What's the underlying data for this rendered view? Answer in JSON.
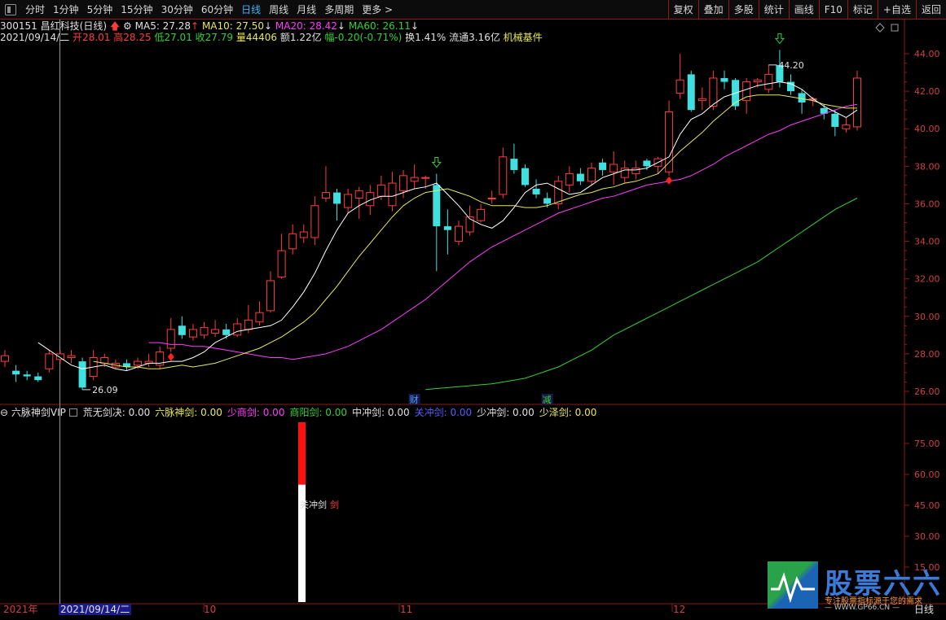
{
  "toolbar": {
    "periods": [
      "分时",
      "1分钟",
      "5分钟",
      "15分钟",
      "30分钟",
      "60分钟",
      "日线",
      "周线",
      "月线",
      "多周期",
      "更多 >"
    ],
    "active_period": "日线",
    "right_buttons": [
      "复权",
      "叠加",
      "多股",
      "统计",
      "画线",
      "F10",
      "标记",
      "+自选",
      "返回"
    ]
  },
  "stock": {
    "code": "300151",
    "name": "昌红科技",
    "period_label": "(日线)",
    "ma5_label": "MA5: 27.28",
    "ma10_label": "MA10: 27.50",
    "ma20_label": "MA20: 28.42",
    "ma60_label": "MA60: 26.11"
  },
  "quote": {
    "date": "2021/09/14/二",
    "open_label": "开",
    "open": "28.01",
    "high_label": "高",
    "high": "28.25",
    "low_label": "低",
    "low": "27.01",
    "close_label": "收",
    "close": "27.79",
    "volume_label": "量",
    "volume": "44406",
    "amount": "额1.22亿",
    "change": "幅-0.20(-0.71%)",
    "turnover": "换1.41%",
    "float_cap": "流通3.16亿",
    "sector": "机械基件"
  },
  "price_axis": [
    "44.00",
    "42.00",
    "40.00",
    "38.00",
    "36.00",
    "34.00",
    "32.00",
    "30.00",
    "28.00",
    "26.00"
  ],
  "annotations": {
    "high_mark": "44.20",
    "low_mark": "26.09",
    "event1": "财",
    "event2": "减"
  },
  "indicator": {
    "name": "六脉神剑VIP",
    "items": [
      {
        "label": "荒无剑决: 0.00",
        "color": "#e0e0e0"
      },
      {
        "label": "六脉神剑: 0.00",
        "color": "#e8e85a"
      },
      {
        "label": "少商剑: 0.00",
        "color": "#ff3cff"
      },
      {
        "label": "商阳剑: 0.00",
        "color": "#34d134"
      },
      {
        "label": "中冲剑: 0.00",
        "color": "#e0e0e0"
      },
      {
        "label": "关冲剑: 0.00",
        "color": "#5a5aff"
      },
      {
        "label": "少冲剑: 0.00",
        "color": "#e0e0e0"
      },
      {
        "label": "少泽剑: 0.00",
        "color": "#e8e85a"
      }
    ],
    "axis": [
      "75.00",
      "60.00",
      "45.00",
      "30.00",
      "15.00"
    ],
    "bar_label_1": "关冲剑",
    "bar_label_2": "剑"
  },
  "time_axis": {
    "year": "2021年",
    "cursor_date": "2021/09/14/二",
    "months": [
      "10",
      "11",
      "12"
    ],
    "right_label": "日线"
  },
  "logo": {
    "title": "股票六六",
    "subtitle": "专注股票指标源于您的需求",
    "url": "— WWW.GP66.CN —"
  },
  "colors": {
    "up": "#ff3c3c",
    "down": "#40e0e0",
    "ma5": "#ffffff",
    "ma10": "#e8e85a",
    "ma20": "#ff3cff",
    "ma60": "#34d134",
    "frame": "#8b1a1a"
  },
  "chart_data": {
    "type": "candlestick",
    "price_range": [
      25.5,
      44.8
    ],
    "candles": [
      {
        "o": 27.6,
        "c": 27.9,
        "h": 28.2,
        "l": 27.3
      },
      {
        "o": 27.1,
        "c": 26.9,
        "h": 27.4,
        "l": 26.5
      },
      {
        "o": 26.9,
        "c": 26.8,
        "h": 27.1,
        "l": 26.6
      },
      {
        "o": 26.8,
        "c": 26.6,
        "h": 27.0,
        "l": 26.5
      },
      {
        "o": 27.2,
        "c": 28.0,
        "h": 28.2,
        "l": 27.0
      },
      {
        "o": 27.7,
        "c": 28.0,
        "h": 28.2,
        "l": 27.5
      },
      {
        "o": 27.8,
        "c": 27.9,
        "h": 28.2,
        "l": 27.5
      },
      {
        "o": 27.6,
        "c": 26.2,
        "h": 27.8,
        "l": 26.09
      },
      {
        "o": 26.8,
        "c": 27.8,
        "h": 28.2,
        "l": 26.6
      },
      {
        "o": 27.5,
        "c": 27.8,
        "h": 28.0,
        "l": 27.3
      },
      {
        "o": 27.3,
        "c": 27.5,
        "h": 27.7,
        "l": 27.2
      },
      {
        "o": 27.5,
        "c": 27.3,
        "h": 27.7,
        "l": 27.1
      },
      {
        "o": 27.4,
        "c": 27.6,
        "h": 27.8,
        "l": 27.2
      },
      {
        "o": 27.5,
        "c": 27.6,
        "h": 28.0,
        "l": 27.3
      },
      {
        "o": 27.4,
        "c": 28.1,
        "h": 28.4,
        "l": 27.2
      },
      {
        "o": 28.3,
        "c": 29.3,
        "h": 29.9,
        "l": 28.1
      },
      {
        "o": 29.5,
        "c": 29.0,
        "h": 30.0,
        "l": 28.8
      },
      {
        "o": 28.9,
        "c": 29.3,
        "h": 29.6,
        "l": 28.7
      },
      {
        "o": 29.0,
        "c": 29.4,
        "h": 29.7,
        "l": 28.8
      },
      {
        "o": 29.1,
        "c": 29.3,
        "h": 29.8,
        "l": 28.9
      },
      {
        "o": 29.3,
        "c": 29.0,
        "h": 29.6,
        "l": 28.8
      },
      {
        "o": 29.0,
        "c": 29.6,
        "h": 29.9,
        "l": 28.9
      },
      {
        "o": 29.3,
        "c": 29.8,
        "h": 30.6,
        "l": 29.1
      },
      {
        "o": 29.7,
        "c": 30.2,
        "h": 30.8,
        "l": 29.5
      },
      {
        "o": 30.3,
        "c": 31.9,
        "h": 32.4,
        "l": 30.2
      },
      {
        "o": 32.1,
        "c": 33.5,
        "h": 34.4,
        "l": 32.0
      },
      {
        "o": 33.6,
        "c": 34.4,
        "h": 34.9,
        "l": 33.3
      },
      {
        "o": 34.2,
        "c": 34.5,
        "h": 34.9,
        "l": 33.9
      },
      {
        "o": 34.2,
        "c": 35.9,
        "h": 36.4,
        "l": 33.8
      },
      {
        "o": 36.3,
        "c": 36.6,
        "h": 38.0,
        "l": 36.1
      },
      {
        "o": 36.6,
        "c": 36.0,
        "h": 36.8,
        "l": 35.1
      },
      {
        "o": 35.8,
        "c": 36.5,
        "h": 36.8,
        "l": 35.5
      },
      {
        "o": 36.3,
        "c": 36.7,
        "h": 36.9,
        "l": 35.2
      },
      {
        "o": 35.9,
        "c": 36.6,
        "h": 37.0,
        "l": 35.4
      },
      {
        "o": 36.4,
        "c": 37.0,
        "h": 37.5,
        "l": 36.2
      },
      {
        "o": 35.9,
        "c": 37.1,
        "h": 37.7,
        "l": 35.6
      },
      {
        "o": 36.7,
        "c": 37.5,
        "h": 37.8,
        "l": 36.3
      },
      {
        "o": 37.2,
        "c": 37.4,
        "h": 38.1,
        "l": 36.8
      },
      {
        "o": 37.4,
        "c": 37.4,
        "h": 37.5,
        "l": 36.8
      },
      {
        "o": 37.0,
        "c": 34.8,
        "h": 37.6,
        "l": 32.4
      },
      {
        "o": 34.8,
        "c": 34.6,
        "h": 35.7,
        "l": 33.3
      },
      {
        "o": 34.0,
        "c": 34.8,
        "h": 35.1,
        "l": 33.8
      },
      {
        "o": 34.5,
        "c": 35.3,
        "h": 35.9,
        "l": 34.3
      },
      {
        "o": 35.1,
        "c": 35.7,
        "h": 36.0,
        "l": 35.0
      },
      {
        "o": 36.3,
        "c": 36.3,
        "h": 36.7,
        "l": 36.0
      },
      {
        "o": 36.5,
        "c": 38.5,
        "h": 39.0,
        "l": 36.3
      },
      {
        "o": 38.4,
        "c": 37.8,
        "h": 39.2,
        "l": 37.6
      },
      {
        "o": 37.9,
        "c": 37.0,
        "h": 38.1,
        "l": 36.9
      },
      {
        "o": 36.8,
        "c": 36.5,
        "h": 37.3,
        "l": 36.3
      },
      {
        "o": 36.3,
        "c": 36.0,
        "h": 36.6,
        "l": 35.8
      },
      {
        "o": 36.0,
        "c": 37.2,
        "h": 37.5,
        "l": 35.7
      },
      {
        "o": 37.0,
        "c": 37.6,
        "h": 38.0,
        "l": 36.6
      },
      {
        "o": 37.6,
        "c": 37.2,
        "h": 37.9,
        "l": 37.0
      },
      {
        "o": 37.2,
        "c": 37.9,
        "h": 38.2,
        "l": 37.0
      },
      {
        "o": 38.2,
        "c": 37.8,
        "h": 38.4,
        "l": 37.5
      },
      {
        "o": 37.7,
        "c": 38.1,
        "h": 38.8,
        "l": 37.0
      },
      {
        "o": 37.4,
        "c": 37.9,
        "h": 38.3,
        "l": 37.1
      },
      {
        "o": 37.6,
        "c": 37.9,
        "h": 38.3,
        "l": 37.3
      },
      {
        "o": 38.3,
        "c": 38.0,
        "h": 38.4,
        "l": 37.8
      },
      {
        "o": 38.0,
        "c": 38.4,
        "h": 38.5,
        "l": 37.6
      },
      {
        "o": 37.7,
        "c": 40.9,
        "h": 41.5,
        "l": 37.5
      },
      {
        "o": 41.9,
        "c": 42.6,
        "h": 44.0,
        "l": 41.6
      },
      {
        "o": 42.9,
        "c": 41.0,
        "h": 43.1,
        "l": 40.9
      },
      {
        "o": 41.5,
        "c": 41.6,
        "h": 42.2,
        "l": 41.0
      },
      {
        "o": 41.2,
        "c": 42.7,
        "h": 43.1,
        "l": 41.0
      },
      {
        "o": 42.7,
        "c": 42.5,
        "h": 43.1,
        "l": 42.1
      },
      {
        "o": 42.6,
        "c": 41.2,
        "h": 42.7,
        "l": 41.0
      },
      {
        "o": 41.5,
        "c": 42.5,
        "h": 42.7,
        "l": 40.8
      },
      {
        "o": 42.5,
        "c": 42.6,
        "h": 42.7,
        "l": 42.2
      },
      {
        "o": 42.1,
        "c": 42.9,
        "h": 43.4,
        "l": 41.9
      },
      {
        "o": 43.4,
        "c": 42.5,
        "h": 44.2,
        "l": 42.2
      },
      {
        "o": 42.5,
        "c": 42.0,
        "h": 42.9,
        "l": 41.8
      },
      {
        "o": 41.9,
        "c": 41.4,
        "h": 42.1,
        "l": 40.8
      },
      {
        "o": 41.6,
        "c": 41.6,
        "h": 41.7,
        "l": 41.2
      },
      {
        "o": 41.1,
        "c": 40.8,
        "h": 41.3,
        "l": 40.5
      },
      {
        "o": 40.8,
        "c": 40.1,
        "h": 41.0,
        "l": 39.6
      },
      {
        "o": 40.0,
        "c": 40.2,
        "h": 40.6,
        "l": 39.8
      },
      {
        "o": 40.1,
        "c": 42.7,
        "h": 43.1,
        "l": 39.9
      }
    ],
    "ma5": [
      28.6,
      28.2,
      27.8,
      27.4,
      27.2,
      27.3,
      27.4,
      27.2,
      27.1,
      27.3,
      27.5,
      27.5,
      27.6,
      27.6,
      27.8,
      28.1,
      28.6,
      28.9,
      29.2,
      29.3,
      29.4,
      29.5,
      29.8,
      30.5,
      31.3,
      32.3,
      33.5,
      34.6,
      35.5,
      35.9,
      36.2,
      36.4,
      36.4,
      36.6,
      36.8,
      36.9,
      37.1,
      36.5,
      35.9,
      35.2,
      34.9,
      34.7,
      35.1,
      35.8,
      36.6,
      37.0,
      37.1,
      36.8,
      36.5,
      36.6,
      37.0,
      37.4,
      37.6,
      37.8,
      37.8,
      37.9,
      38.2,
      38.5,
      39.7,
      40.5,
      40.8,
      41.3,
      41.7,
      41.9,
      42.1,
      42.3,
      42.4,
      42.5,
      42.4,
      42.1,
      41.6,
      41.2,
      40.9,
      40.6,
      41.0
    ],
    "ma10": [
      27.6,
      27.5,
      27.4,
      27.3,
      27.3,
      27.2,
      27.2,
      27.3,
      27.4,
      27.3,
      27.4,
      27.5,
      27.7,
      27.9,
      28.1,
      28.3,
      28.6,
      28.9,
      29.3,
      29.7,
      30.2,
      30.9,
      31.6,
      32.4,
      33.2,
      33.9,
      34.6,
      35.3,
      35.9,
      36.3,
      36.6,
      36.7,
      36.8,
      36.6,
      36.4,
      36.1,
      35.9,
      35.9,
      35.9,
      35.8,
      35.8,
      35.9,
      36.1,
      36.3,
      36.5,
      36.6,
      36.8,
      36.9,
      37.1,
      37.2,
      37.4,
      37.6,
      38.2,
      38.8,
      39.3,
      39.8,
      40.4,
      40.9,
      41.4,
      41.7,
      41.8,
      41.8,
      41.8,
      41.7,
      41.6,
      41.5,
      41.3,
      41.2,
      41.1,
      41.1
    ],
    "ma20": [
      28.6,
      28.6,
      28.5,
      28.5,
      28.4,
      28.4,
      28.3,
      28.2,
      28.1,
      28.0,
      27.9,
      27.8,
      27.8,
      27.7,
      27.8,
      27.9,
      28.0,
      28.2,
      28.4,
      28.7,
      29.0,
      29.3,
      29.7,
      30.1,
      30.5,
      30.9,
      31.4,
      31.9,
      32.4,
      32.9,
      33.3,
      33.7,
      34.0,
      34.3,
      34.6,
      34.9,
      35.2,
      35.5,
      35.7,
      35.9,
      36.1,
      36.3,
      36.4,
      36.6,
      36.8,
      37.0,
      37.1,
      37.2,
      37.3,
      37.5,
      37.8,
      38.1,
      38.5,
      38.8,
      39.1,
      39.4,
      39.7,
      39.9,
      40.2,
      40.4,
      40.6,
      40.8,
      41.0,
      41.2,
      41.3
    ],
    "ma60": [
      26.1,
      26.15,
      26.2,
      26.25,
      26.3,
      26.35,
      26.4,
      26.5,
      26.6,
      26.7,
      26.9,
      27.1,
      27.3,
      27.6,
      27.9,
      28.2,
      28.6,
      29.0,
      29.3,
      29.6,
      29.9,
      30.2,
      30.5,
      30.8,
      31.1,
      31.4,
      31.7,
      32.0,
      32.3,
      32.6,
      32.9,
      33.3,
      33.7,
      34.1,
      34.5,
      34.9,
      35.3,
      35.7,
      36.0,
      36.3
    ]
  }
}
